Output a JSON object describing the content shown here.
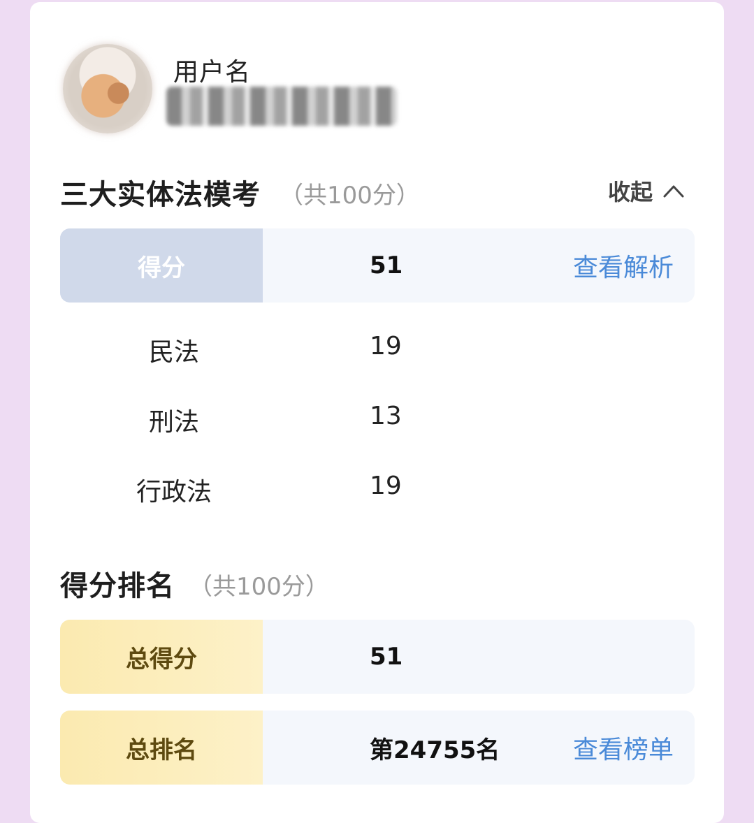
{
  "user": {
    "username_label": "用户名"
  },
  "section1": {
    "title": "三大实体法模考",
    "subtitle": "（共100分）",
    "collapse_label": "收起",
    "score_label": "得分",
    "score_value": "51",
    "analysis_link": "查看解析",
    "subjects": [
      {
        "name": "民法",
        "score": "19"
      },
      {
        "name": "刑法",
        "score": "13"
      },
      {
        "name": "行政法",
        "score": "19"
      }
    ]
  },
  "section2": {
    "title": "得分排名",
    "subtitle": "（共100分）",
    "total_score_label": "总得分",
    "total_score_value": "51",
    "total_rank_label": "总排名",
    "total_rank_value": "第24755名",
    "leaderboard_link": "查看榜单"
  },
  "colors": {
    "link": "#4a8ad8",
    "score_label_bg": "#d0d9ea",
    "rank_label_bg": "#fbeab0",
    "page_bg": "#eedcf3"
  },
  "icons": {
    "collapse": "chevron-up-icon"
  }
}
